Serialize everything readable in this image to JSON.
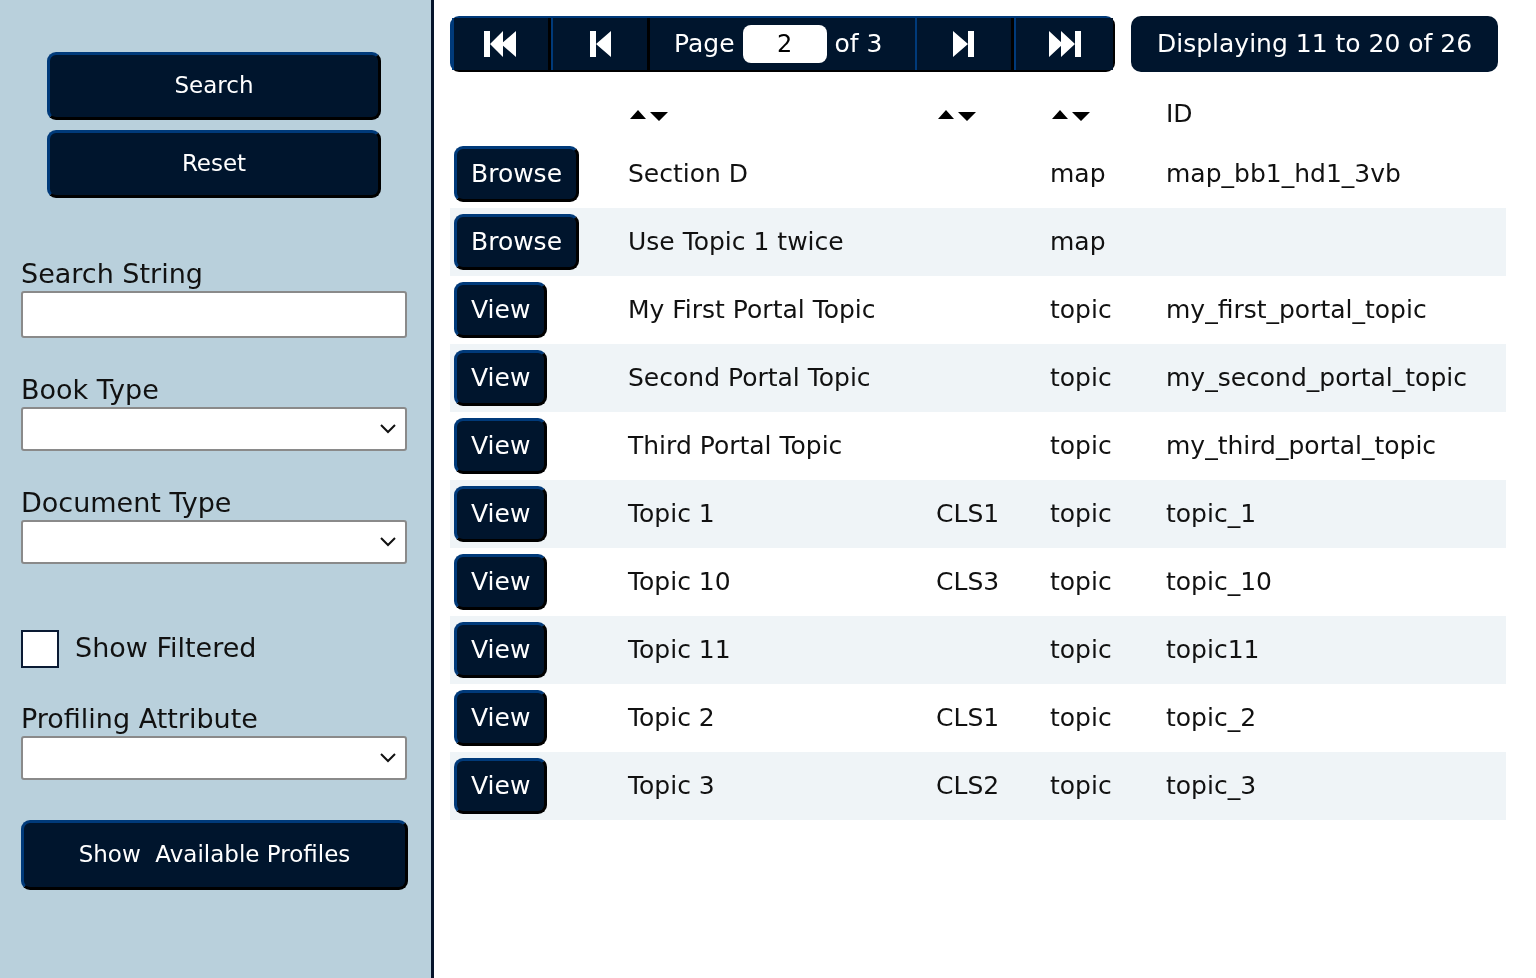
{
  "sidebar": {
    "buttons": [
      "Search",
      "Reset"
    ],
    "fields": [
      {
        "kind": "text",
        "label": "Search String"
      },
      {
        "kind": "select",
        "label": "Book Type"
      },
      {
        "kind": "select",
        "label": "Document Type"
      },
      {
        "kind": "checkbox",
        "label": "Show Filtered",
        "checked": false
      },
      {
        "kind": "select",
        "label": "Profiling Attribute"
      }
    ],
    "bottom_button": "Show  Available Profiles"
  },
  "pager": {
    "page_label": "Page",
    "page_value": "2",
    "of_label": "of 3",
    "status": "Displaying 11 to 20 of 26"
  },
  "table": {
    "columns": [
      {
        "sortable": false
      },
      {
        "sortable": true
      },
      {
        "sortable": true
      },
      {
        "sortable": true
      },
      {
        "label": "ID",
        "sortable": false
      }
    ],
    "rows": [
      {
        "action": "Browse",
        "title": "Section D",
        "type": "map",
        "id": "map_bb1_hd1_3vb"
      },
      {
        "action": "Browse",
        "title": "Use Topic 1 twice",
        "type": "map"
      },
      {
        "action": "View",
        "title": "My First Portal Topic",
        "type": "topic",
        "id": "my_first_portal_topic"
      },
      {
        "action": "View",
        "title": "Second Portal Topic",
        "type": "topic",
        "id": "my_second_portal_topic"
      },
      {
        "action": "View",
        "title": "Third Portal Topic",
        "type": "topic",
        "id": "my_third_portal_topic"
      },
      {
        "action": "View",
        "title": "Topic 1",
        "column_3": "CLS1",
        "type": "topic",
        "id": "topic_1"
      },
      {
        "action": "View",
        "title": "Topic 10",
        "column_3": "CLS3",
        "type": "topic",
        "id": "topic_10"
      },
      {
        "action": "View",
        "title": "Topic 11",
        "type": "topic",
        "id": "topic11"
      },
      {
        "action": "View",
        "title": "Topic 2",
        "column_3": "CLS1",
        "type": "topic",
        "id": "topic_2"
      },
      {
        "action": "View",
        "title": "Topic 3",
        "column_3": "CLS2",
        "type": "topic",
        "id": "topic_3"
      }
    ]
  }
}
